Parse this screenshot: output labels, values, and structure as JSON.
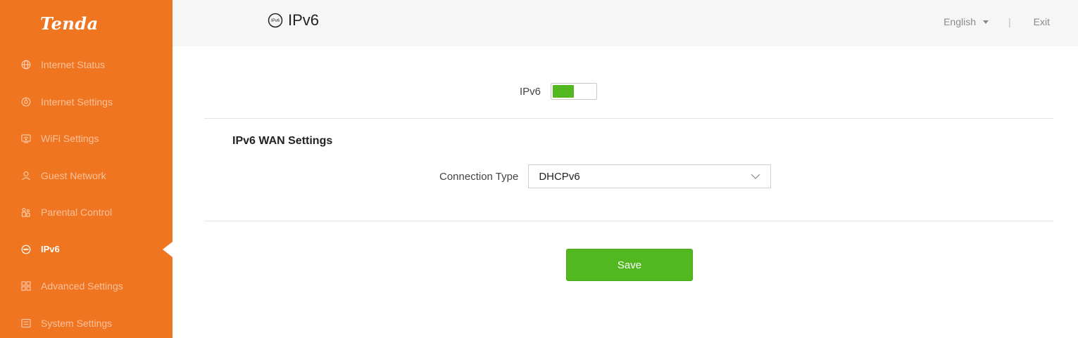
{
  "brand": {
    "logo_text": "Tenda",
    "accent_color": "#f07520",
    "active_color": "#52b820"
  },
  "sidebar": {
    "items": [
      {
        "label": "Internet Status",
        "icon": "globe-icon",
        "active": false
      },
      {
        "label": "Internet Settings",
        "icon": "network-icon",
        "active": false
      },
      {
        "label": "WiFi Settings",
        "icon": "wifi-icon",
        "active": false
      },
      {
        "label": "Guest Network",
        "icon": "guest-icon",
        "active": false
      },
      {
        "label": "Parental Control",
        "icon": "parental-icon",
        "active": false
      },
      {
        "label": "IPv6",
        "icon": "ipv6-icon",
        "active": true
      },
      {
        "label": "Advanced Settings",
        "icon": "grid-icon",
        "active": false
      },
      {
        "label": "System Settings",
        "icon": "system-icon",
        "active": false
      }
    ]
  },
  "header": {
    "title": "IPv6",
    "title_icon": "ipv6-icon",
    "language": "English",
    "separator": "|",
    "exit_label": "Exit"
  },
  "main": {
    "toggle_label": "IPv6",
    "toggle_on": true,
    "section_title": "IPv6 WAN Settings",
    "connection_type_label": "Connection Type",
    "connection_type_value": "DHCPv6",
    "save_label": "Save"
  }
}
